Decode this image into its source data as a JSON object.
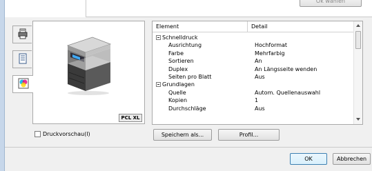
{
  "top": {
    "partial_button_label": "Ok wählen"
  },
  "tabs": [
    {
      "icon": "printer-list-icon"
    },
    {
      "icon": "document-icon"
    },
    {
      "icon": "color-icon"
    }
  ],
  "preview": {
    "badge": "PCL XL",
    "printer_icon": "printer-mfp-image"
  },
  "print_preview": {
    "label": "Druckvorschau(I)",
    "checked": false
  },
  "table": {
    "col_element": "Element",
    "col_detail": "Detail",
    "rows": [
      {
        "type": "group",
        "label": "Schnelldruck"
      },
      {
        "type": "item",
        "label": "Ausrichtung",
        "value": "Hochformat"
      },
      {
        "type": "item",
        "label": "Farbe",
        "value": "Mehrfarbig"
      },
      {
        "type": "item",
        "label": "Sortieren",
        "value": "An"
      },
      {
        "type": "item",
        "label": "Duplex",
        "value": "An Längsseite wenden"
      },
      {
        "type": "item",
        "label": "Seiten pro Blatt",
        "value": "Aus"
      },
      {
        "type": "group",
        "label": "Grundlagen"
      },
      {
        "type": "item",
        "label": "Quelle",
        "value": "Autom. Quellenauswahl"
      },
      {
        "type": "item",
        "label": "Kopien",
        "value": "1"
      },
      {
        "type": "item",
        "label": "Durchschläge",
        "value": "Aus"
      }
    ]
  },
  "buttons": {
    "save_as": "Speichern als...",
    "profile": "Profil...",
    "ok": "OK",
    "cancel": "Abbrechen"
  }
}
